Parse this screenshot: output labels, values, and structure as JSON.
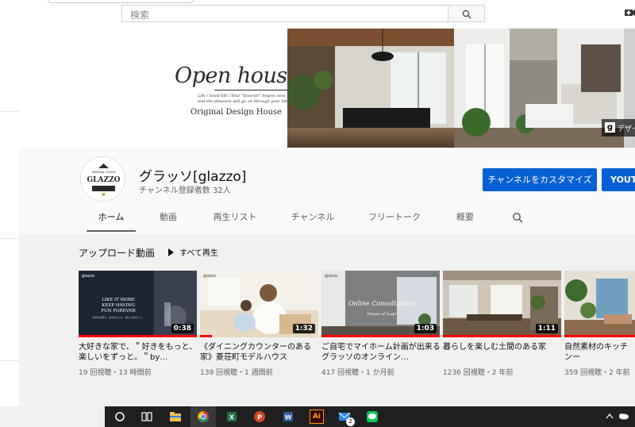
{
  "search": {
    "placeholder": "検索"
  },
  "banner": {
    "title": "Open house",
    "tagline_1": "Life / Good life / Your \"favorite\" begins now,",
    "tagline_2": "and the pleasure will go on through your life.",
    "subtitle": "Original Design House",
    "link_label": "デザイ"
  },
  "channel": {
    "name": "グラッソ[glazzo]",
    "subscribers": "チャンネル登録者数 32人",
    "avatar_lines": [
      "ORIGINAL HOUSE",
      "GLAZZO"
    ],
    "customize_label": "チャンネルをカスタマイズ",
    "youtube_label": "YOUTU"
  },
  "tabs": [
    {
      "label": "ホーム",
      "active": true
    },
    {
      "label": "動画"
    },
    {
      "label": "再生リスト"
    },
    {
      "label": "チャンネル"
    },
    {
      "label": "フリートーク"
    },
    {
      "label": "概要"
    }
  ],
  "uploads": {
    "title": "アップロード動画",
    "play_all": "すべて再生",
    "videos": [
      {
        "title": "大好きな家で、＂好きをもっと、楽しいをずっと。＂by…",
        "meta": "19 回視聴・13 時間前",
        "duration": "0:38",
        "thumb_logo": "glazzo",
        "thumb_text": [
          "LIKE IT MORE",
          "KEEP HAVING",
          "FUN FOREVER"
        ],
        "thumb_jp": "大好きな家で、好きをもっと、楽しいをずっと。",
        "progress": 1.0
      },
      {
        "title": "《ダイニングカウンターのある家》菱荘町モデルハウス",
        "meta": "139 回視聴・1 週間前",
        "duration": "1:32",
        "thumb_logo": "glazzo",
        "progress": 0.1
      },
      {
        "title": "ご自宅でマイホーム計画が出来るグラッソのオンライン…",
        "meta": "417 回視聴・1 か月前",
        "duration": "1:03",
        "thumb_logo": "glazzo",
        "thumb_text": [
          "Online Consultation!",
          "House of Sage"
        ],
        "progress": 1.0
      },
      {
        "title": "暮らしを楽しむ土間のある家",
        "meta": "1236 回視聴・2 年前",
        "duration": "1:11",
        "progress": 1.0
      },
      {
        "title": "自然素材のキッチンー",
        "meta": "359 回視聴・2 年前",
        "progress": 1.0
      }
    ]
  },
  "taskbar": {
    "mail_badge": "2",
    "illustrator_label": "Ai"
  },
  "colors": {
    "accent": "#065fd4",
    "progress": "#ff0000"
  }
}
